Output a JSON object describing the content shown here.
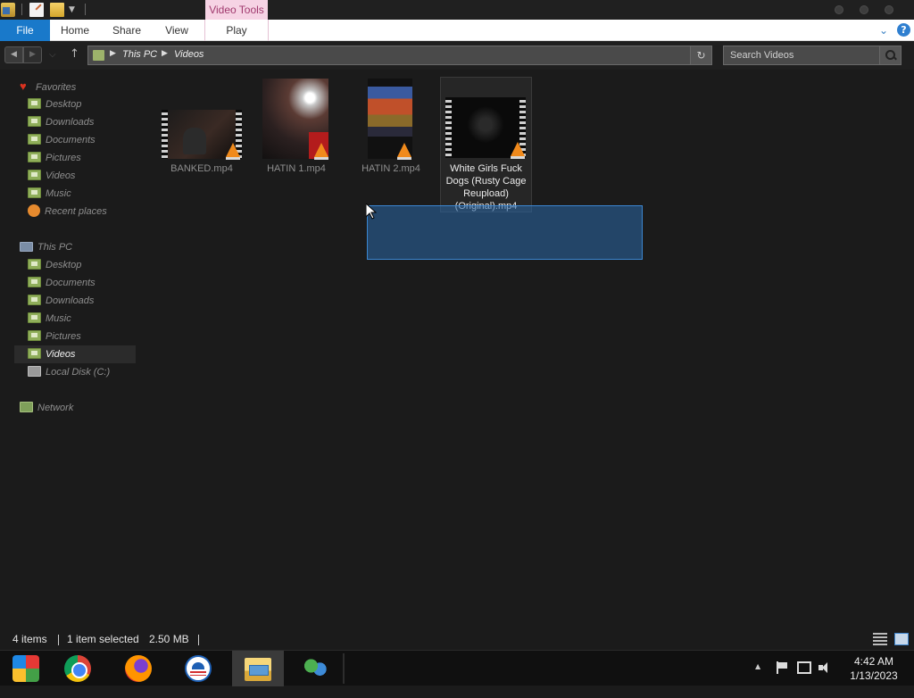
{
  "titlebar": {
    "contextual_tab": "Video Tools"
  },
  "ribbon": {
    "tabs": [
      {
        "label": "File"
      },
      {
        "label": "Home"
      },
      {
        "label": "Share"
      },
      {
        "label": "View"
      },
      {
        "label": "Play"
      }
    ],
    "expand_icon": "chevron-down-icon",
    "help_label": "?"
  },
  "address": {
    "crumbs": [
      "This PC",
      "Videos"
    ]
  },
  "search": {
    "placeholder": "Search Videos"
  },
  "nav": {
    "favorites": {
      "label": "Favorites",
      "items": [
        "Desktop",
        "Downloads",
        "Documents",
        "Pictures",
        "Videos",
        "Music",
        "Recent places"
      ]
    },
    "this_pc": {
      "label": "This PC",
      "items": [
        "Desktop",
        "Documents",
        "Downloads",
        "Music",
        "Pictures",
        "Videos",
        "Local Disk (C:)"
      ],
      "selected": "Videos"
    },
    "network": {
      "label": "Network"
    }
  },
  "files": [
    {
      "name": "BANKED.mp4",
      "selected": false
    },
    {
      "name": "HATIN 1.mp4",
      "selected": false
    },
    {
      "name": "HATIN 2.mp4",
      "selected": false
    },
    {
      "name": "White Girls Fuck Dogs (Rusty Cage Reupload) (Original).mp4",
      "selected": true
    }
  ],
  "status": {
    "item_count": "4 items",
    "selection": "1 item selected",
    "size": "2.50 MB"
  },
  "taskbar": {
    "apps": [
      "paint-icon",
      "chrome-icon",
      "firefox-icon",
      "obama-icon",
      "file-explorer-icon",
      "people-icon"
    ],
    "active_app": "file-explorer-icon",
    "time": "4:42 AM",
    "date": "1/13/2023"
  }
}
